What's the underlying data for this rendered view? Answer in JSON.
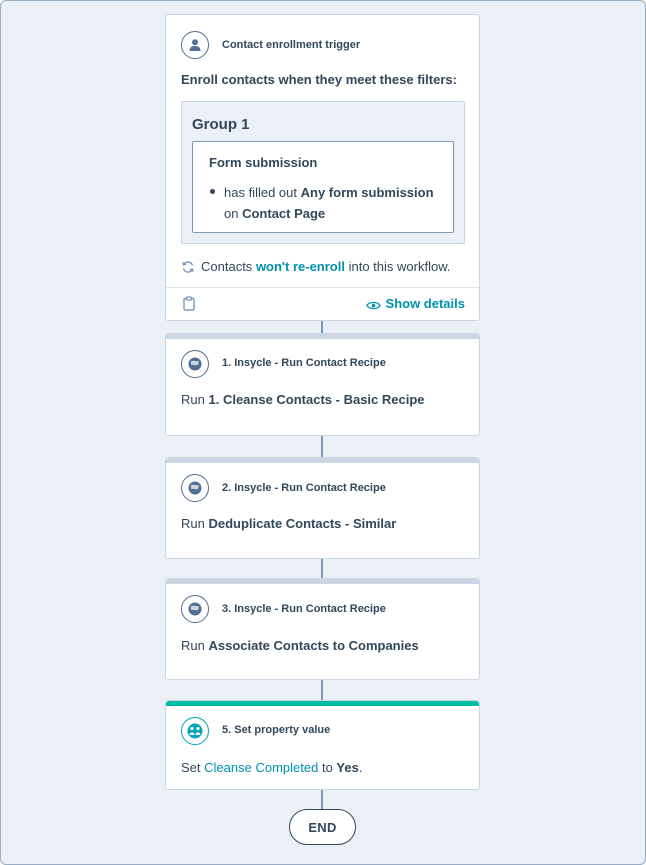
{
  "trigger": {
    "title": "Contact enrollment trigger",
    "heading": "Enroll contacts when they meet these filters:",
    "group_title": "Group 1",
    "filter_title": "Form submission",
    "filter_prefix": "has filled out",
    "filter_value": "Any form submission",
    "filter_on": "on",
    "filter_page": "Contact Page",
    "reenroll_prefix": "Contacts",
    "reenroll_link": "won't re-enroll",
    "reenroll_suffix": "into this workflow.",
    "show_details": "Show details",
    "icons": [
      "user-icon",
      "refresh-icon",
      "clipboard-icon",
      "eye-icon"
    ]
  },
  "actions": [
    {
      "title": "1. Insycle - Run Contact Recipe",
      "run_label": "Run",
      "recipe": "1. Cleanse Contacts - Basic Recipe",
      "icon": "insycle-icon",
      "accent": "#cbd6e2"
    },
    {
      "title": "2. Insycle - Run Contact Recipe",
      "run_label": "Run",
      "recipe": "Deduplicate Contacts - Similar",
      "icon": "insycle-icon",
      "accent": "#cbd6e2"
    },
    {
      "title": "3. Insycle - Run Contact Recipe",
      "run_label": "Run",
      "recipe": "Associate Contacts to Companies",
      "icon": "insycle-icon",
      "accent": "#cbd6e2"
    }
  ],
  "set_property": {
    "title": "5. Set property value",
    "set_label": "Set",
    "property": "Cleanse Completed",
    "to_label": "to",
    "value": "Yes",
    "period": ".",
    "icon": "people-icon",
    "accent": "#00bda5"
  },
  "end_label": "END",
  "colors": {
    "link": "#0091ae",
    "text": "#33475b",
    "canvas": "#eaf0f6",
    "connector": "#7c98b6"
  }
}
